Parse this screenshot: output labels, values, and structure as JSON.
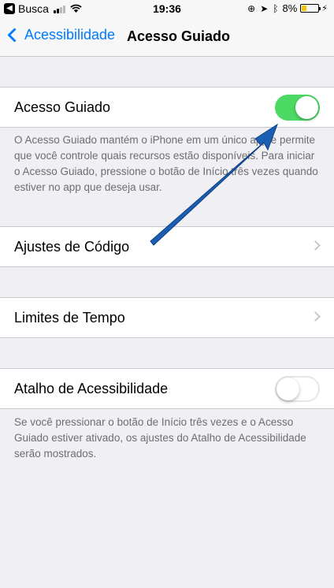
{
  "status_bar": {
    "back_app": "Busca",
    "time": "19:36",
    "battery": "8%"
  },
  "nav": {
    "back_label": "Acessibilidade",
    "title": "Acesso Guiado"
  },
  "guided_access": {
    "label": "Acesso Guiado",
    "enabled": true,
    "footnote": "O Acesso Guiado mantém o iPhone em um único app e permite que você controle quais recursos estão disponíveis. Para iniciar o Acesso Guiado, pressione o botão de Início três vezes quando estiver no app que deseja usar."
  },
  "passcode_settings": {
    "label": "Ajustes de Código"
  },
  "time_limits": {
    "label": "Limites de Tempo"
  },
  "accessibility_shortcut": {
    "label": "Atalho de Acessibilidade",
    "enabled": false,
    "footnote": "Se você pressionar o botão de Início três vezes e o Acesso Guiado estiver ativado, os ajustes do Atalho de Acessibilidade serão mostrados."
  },
  "colors": {
    "accent": "#007aff",
    "switch_on": "#4cd964",
    "arrow": "#1a5fb4"
  }
}
